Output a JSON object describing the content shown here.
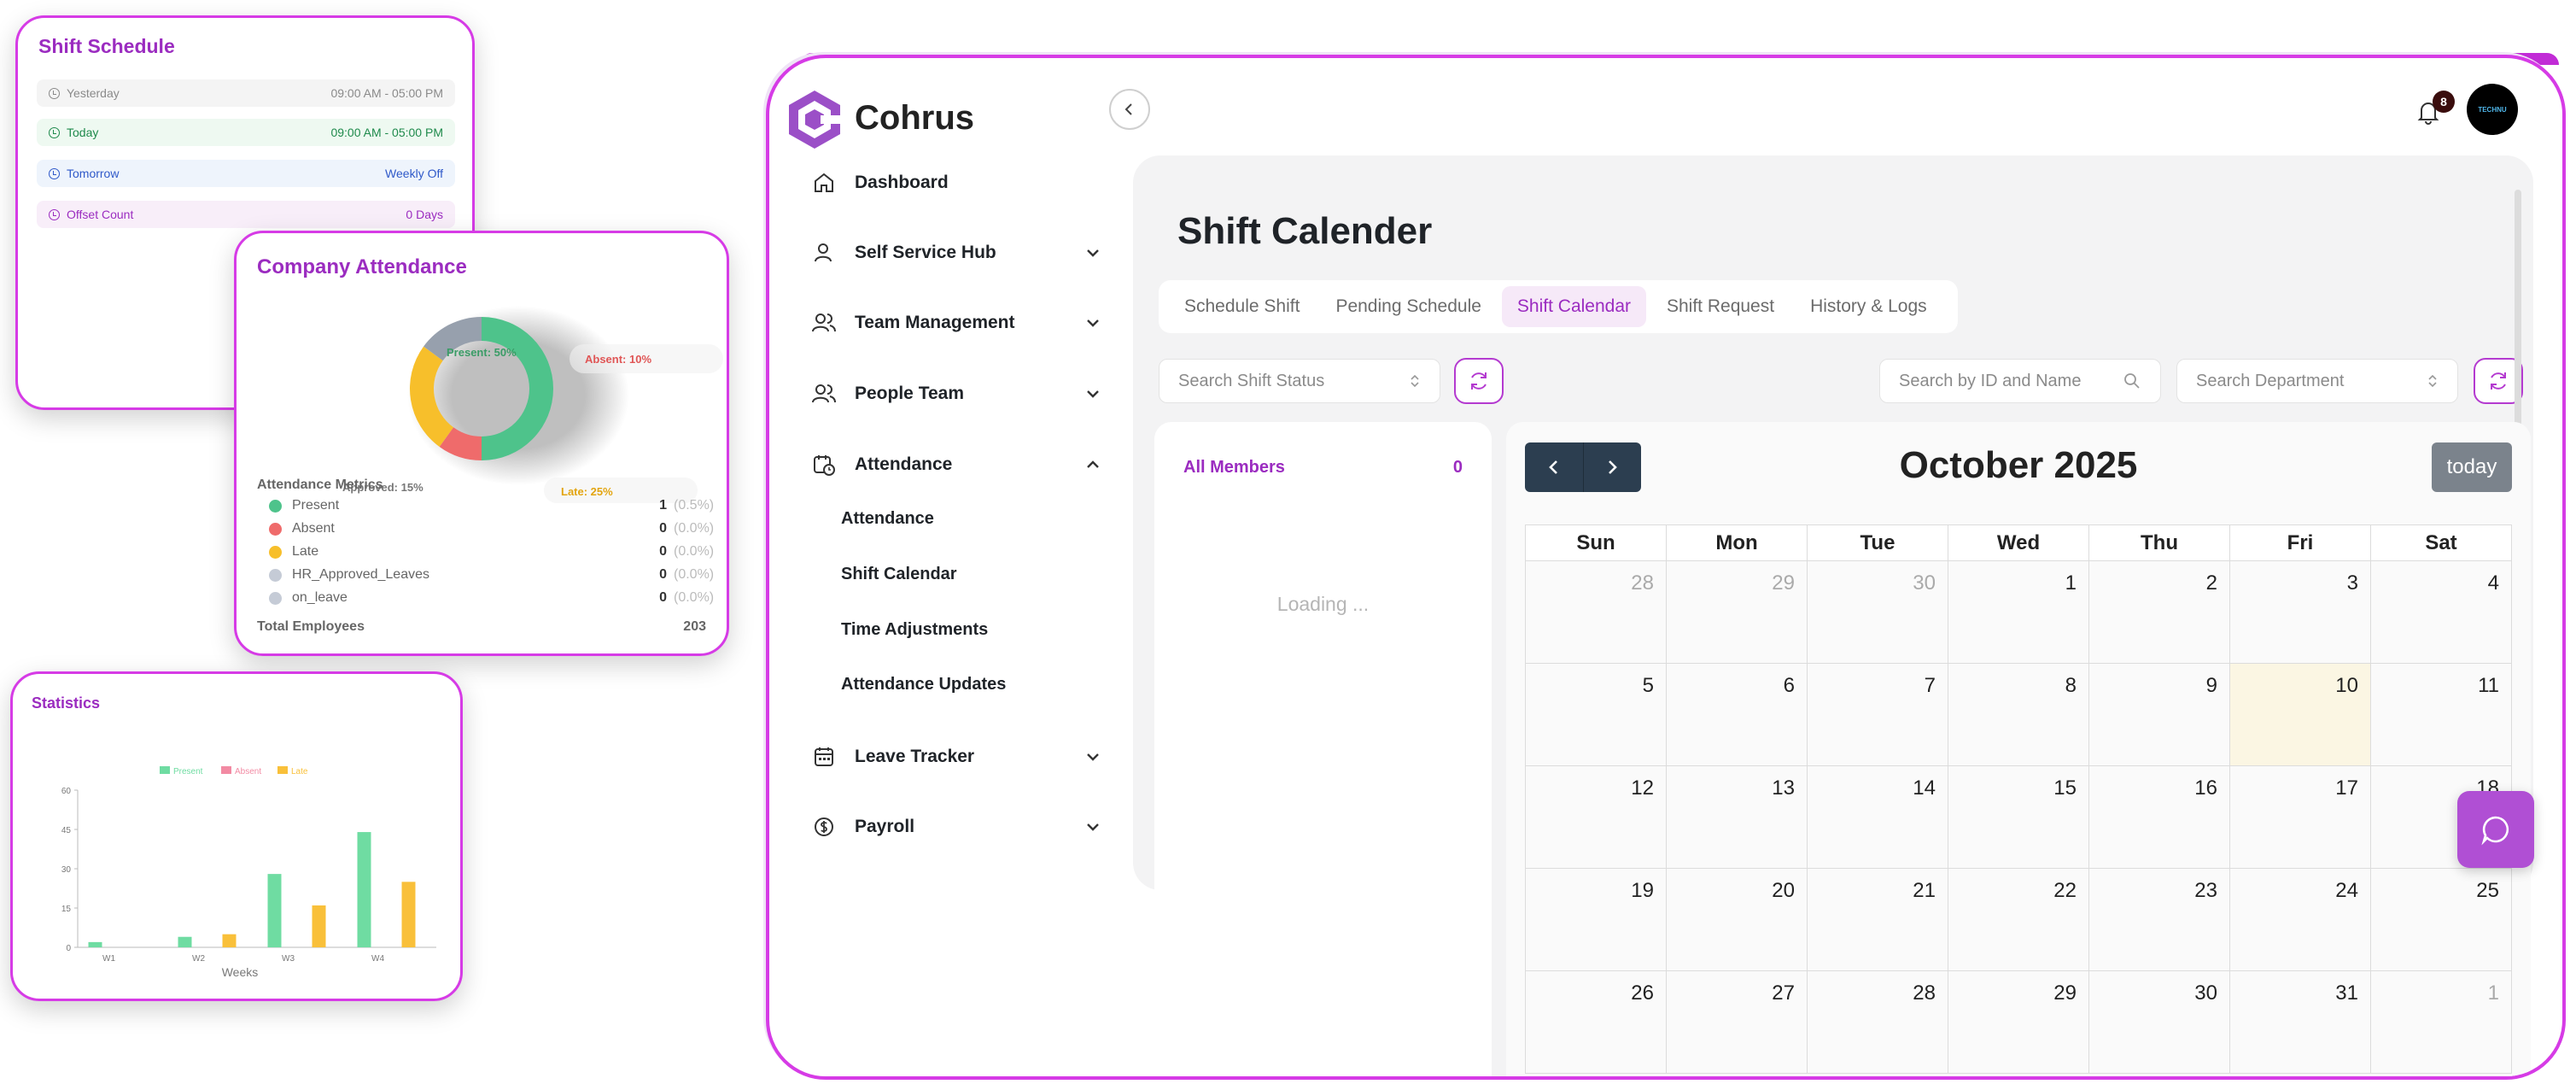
{
  "shift_schedule": {
    "title": "Shift Schedule",
    "rows": [
      {
        "label": "Yesterday",
        "value": "09:00 AM - 05:00 PM",
        "color": "#8a8a8a",
        "bg": "#f4f4f4"
      },
      {
        "label": "Today",
        "value": "09:00 AM - 05:00 PM",
        "color": "#1f8a4c",
        "bg": "#eef9f1"
      },
      {
        "label": "Tomorrow",
        "value": "Weekly Off",
        "color": "#2f59c9",
        "bg": "#eef4fc"
      },
      {
        "label": "Offset Count",
        "value": "0 Days",
        "color": "#9b2cc0",
        "bg": "#f8eef9"
      }
    ]
  },
  "company_attendance": {
    "title": "Company Attendance",
    "donut_labels": {
      "present": "Present: 50%",
      "absent": "Absent: 10%",
      "late": "Late: 25%",
      "approved": "Approved: 15%"
    },
    "metrics_title": "Attendance Metrics",
    "metrics": [
      {
        "name": "Present",
        "value": "1",
        "pct": "(0.5%)",
        "color": "#4ec38b"
      },
      {
        "name": "Absent",
        "value": "0",
        "pct": "(0.0%)",
        "color": "#ef6b6b"
      },
      {
        "name": "Late",
        "value": "0",
        "pct": "(0.0%)",
        "color": "#f7bf2b"
      },
      {
        "name": "HR_Approved_Leaves",
        "value": "0",
        "pct": "(0.0%)",
        "color": "#c5cbd6"
      },
      {
        "name": "on_leave",
        "value": "0",
        "pct": "(0.0%)",
        "color": "#c5cbd6"
      }
    ],
    "total_label": "Total Employees",
    "total_value": "203"
  },
  "chart_data": {
    "type": "bar",
    "title": "Statistics",
    "categories": [
      "W1",
      "W2",
      "W3",
      "W4"
    ],
    "series": [
      {
        "name": "Present",
        "values": [
          2,
          4,
          28,
          44
        ],
        "color": "#6fdca2"
      },
      {
        "name": "Absent",
        "values": [
          0,
          0,
          0,
          0
        ],
        "color": "#f28aa3"
      },
      {
        "name": "Late",
        "values": [
          0,
          5,
          16,
          25
        ],
        "color": "#f9c03a"
      }
    ],
    "xlabel": "Weeks",
    "ylabel": "",
    "ylim": [
      0,
      60
    ],
    "yticks": [
      "0",
      "15",
      "30",
      "45",
      "60"
    ],
    "legend": "top-center"
  },
  "app": {
    "brand": "Cohrus",
    "notification_count": "8",
    "avatar_text": "TECHNU",
    "nav": {
      "dashboard": "Dashboard",
      "self_service": "Self Service Hub",
      "team_management": "Team Management",
      "people_team": "People Team",
      "attendance": "Attendance",
      "attendance_sub": [
        "Attendance",
        "Shift Calendar",
        "Time Adjustments",
        "Attendance Updates"
      ],
      "leave_tracker": "Leave Tracker",
      "payroll": "Payroll"
    },
    "page_title": "Shift Calender",
    "tabs": [
      "Schedule Shift",
      "Pending Schedule",
      "Shift Calendar",
      "Shift Request",
      "History & Logs"
    ],
    "active_tab": "Shift Calendar",
    "filters": {
      "status_placeholder": "Search Shift Status",
      "id_placeholder": "Search by ID and Name",
      "dept_placeholder": "Search Department"
    },
    "members": {
      "label": "All Members",
      "count": "0",
      "loading": "Loading ..."
    },
    "calendar": {
      "month_title": "October 2025",
      "today_button": "today",
      "weekdays": [
        "Sun",
        "Mon",
        "Tue",
        "Wed",
        "Thu",
        "Fri",
        "Sat"
      ],
      "weeks": [
        [
          "28",
          "29",
          "30",
          "1",
          "2",
          "3",
          "4"
        ],
        [
          "5",
          "6",
          "7",
          "8",
          "9",
          "10",
          "11"
        ],
        [
          "12",
          "13",
          "14",
          "15",
          "16",
          "17",
          "18"
        ],
        [
          "19",
          "20",
          "21",
          "22",
          "23",
          "24",
          "25"
        ],
        [
          "26",
          "27",
          "28",
          "29",
          "30",
          "31",
          "1"
        ]
      ],
      "today": "10"
    }
  }
}
